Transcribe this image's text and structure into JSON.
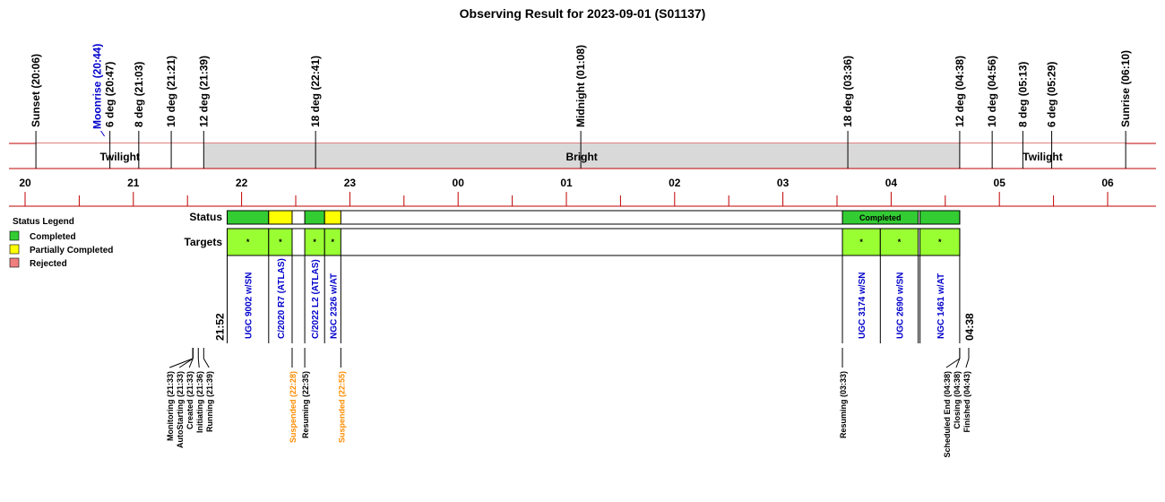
{
  "chart_data": {
    "type": "timeline",
    "title": "Observing Result for 2023-09-01 (S01137)",
    "time_range": [
      "20:00",
      "06:15"
    ],
    "hour_ticks": [
      "20",
      "21",
      "22",
      "23",
      "00",
      "01",
      "02",
      "03",
      "04",
      "05",
      "06"
    ],
    "colors": {
      "rule": "#c00000",
      "twilight": "#ffffff",
      "bright": "#d9d9d9",
      "completed": "#33cc33",
      "partial": "#ffff00",
      "rejected": "#f08080",
      "target": "#99ff33",
      "target_name": "#0000cc",
      "suspended": "#ff8c00",
      "moon": "#0000cc"
    },
    "sky_events": [
      {
        "label": "Sunset (20:06)",
        "time": "20:06"
      },
      {
        "label": "Moonrise (20:44)",
        "time": "20:44",
        "kind": "moon"
      },
      {
        "label": "6 deg (20:47)",
        "time": "20:47"
      },
      {
        "label": "8 deg (21:03)",
        "time": "21:03"
      },
      {
        "label": "10 deg (21:21)",
        "time": "21:21"
      },
      {
        "label": "12 deg (21:39)",
        "time": "21:39"
      },
      {
        "label": "18 deg (22:41)",
        "time": "22:41"
      },
      {
        "label": "Midnight (01:08)",
        "time": "01:08"
      },
      {
        "label": "18 deg (03:36)",
        "time": "03:36"
      },
      {
        "label": "12 deg (04:38)",
        "time": "04:38"
      },
      {
        "label": "10 deg (04:56)",
        "time": "04:56"
      },
      {
        "label": "8 deg (05:13)",
        "time": "05:13"
      },
      {
        "label": "6 deg (05:29)",
        "time": "05:29"
      },
      {
        "label": "Sunrise (06:10)",
        "time": "06:10"
      }
    ],
    "sky_bands": [
      {
        "label": "Twilight",
        "start": "20:06",
        "end": "21:39",
        "kind": "twilight"
      },
      {
        "label": "Bright",
        "start": "21:39",
        "end": "04:38",
        "kind": "bright"
      },
      {
        "label": "Twilight",
        "start": "04:38",
        "end": "06:10",
        "kind": "twilight"
      }
    ],
    "row_labels": {
      "status": "Status",
      "targets": "Targets"
    },
    "status_blocks": [
      {
        "start": "21:52",
        "end": "22:15",
        "status": "completed"
      },
      {
        "start": "22:15",
        "end": "22:28",
        "status": "partial"
      },
      {
        "start": "22:35",
        "end": "22:46",
        "status": "completed"
      },
      {
        "start": "22:46",
        "end": "22:55",
        "status": "partial"
      },
      {
        "start": "03:33",
        "end": "04:15",
        "status": "completed",
        "label": "Completed"
      },
      {
        "start": "04:16",
        "end": "04:38",
        "status": "completed"
      }
    ],
    "target_blocks": [
      {
        "start": "21:52",
        "end": "22:15",
        "name": "UGC 9002 w/SN",
        "mark": "*"
      },
      {
        "start": "22:15",
        "end": "22:28",
        "name": "C/2020 R7 (ATLAS)",
        "mark": "*"
      },
      {
        "start": "22:35",
        "end": "22:46",
        "name": "C/2022 L2 (ATLAS)",
        "mark": "*"
      },
      {
        "start": "22:46",
        "end": "22:55",
        "name": "NGC 2326 w/AT",
        "mark": "*"
      },
      {
        "start": "03:33",
        "end": "03:54",
        "name": "UGC 3174 w/SN",
        "mark": "*"
      },
      {
        "start": "03:54",
        "end": "04:15",
        "name": "UGC 2690 w/SN",
        "mark": "*"
      },
      {
        "start": "04:16",
        "end": "04:38",
        "name": "NGC 1461 w/AT",
        "mark": "*"
      }
    ],
    "window": {
      "start_label": "21:52",
      "start": "21:52",
      "end_label": "04:38",
      "end": "04:38"
    },
    "log_events": [
      {
        "label": "Monitoring (21:33)",
        "time": "21:33"
      },
      {
        "label": "AutoStarting (21:33)",
        "time": "21:33"
      },
      {
        "label": "Created (21:33)",
        "time": "21:33"
      },
      {
        "label": "Initiating (21:36)",
        "time": "21:36"
      },
      {
        "label": "Running (21:39)",
        "time": "21:39"
      },
      {
        "label": "Suspended (22:28)",
        "time": "22:28",
        "kind": "suspended"
      },
      {
        "label": "Resuming (22:35)",
        "time": "22:35"
      },
      {
        "label": "Suspended (22:55)",
        "time": "22:55",
        "kind": "suspended"
      },
      {
        "label": "Resuming (03:33)",
        "time": "03:33"
      },
      {
        "label": "Scheduled End (04:38)",
        "time": "04:38"
      },
      {
        "label": "Closing (04:38)",
        "time": "04:38"
      },
      {
        "label": "Finished (04:43)",
        "time": "04:43"
      }
    ],
    "legend": {
      "title": "Status Legend",
      "items": [
        {
          "label": "Completed",
          "status": "completed"
        },
        {
          "label": "Partially Completed",
          "status": "partial"
        },
        {
          "label": "Rejected",
          "status": "rejected"
        }
      ]
    }
  }
}
